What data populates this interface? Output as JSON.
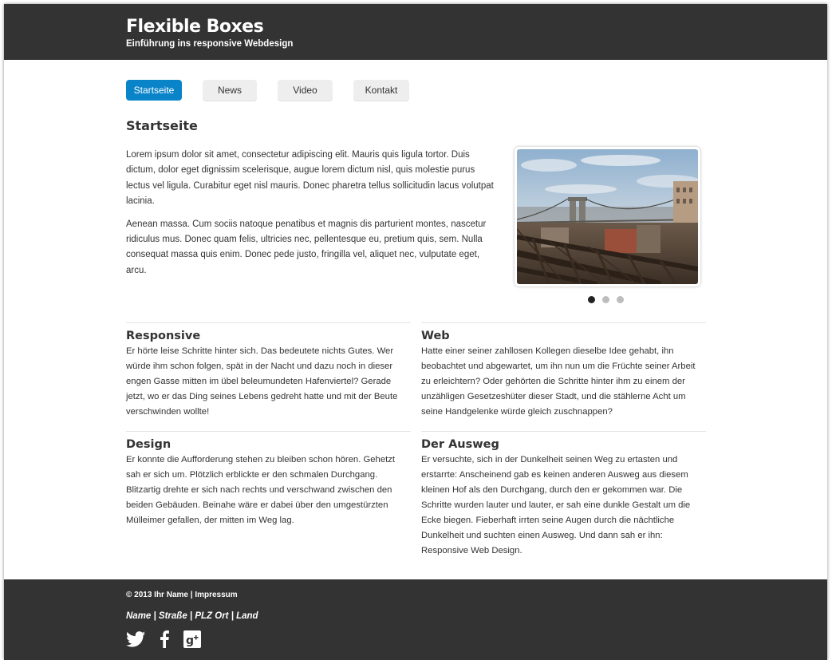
{
  "header": {
    "title": "Flexible Boxes",
    "subtitle": "Einführung ins responsive Webdesign"
  },
  "nav": {
    "items": [
      {
        "label": "Startseite",
        "active": true
      },
      {
        "label": "News",
        "active": false
      },
      {
        "label": "Video",
        "active": false
      },
      {
        "label": "Kontakt",
        "active": false
      }
    ]
  },
  "main": {
    "title": "Startseite",
    "paragraphs": [
      "Lorem ipsum dolor sit amet, consectetur adipiscing elit. Mauris quis ligula tortor. Duis dictum, dolor eget dignissim scelerisque, augue lorem dictum nisl, quis molestie purus lectus vel ligula. Curabitur eget nisl mauris. Donec pharetra tellus sollicitudin lacus volutpat lacinia.",
      "Aenean massa. Cum sociis natoque penatibus et magnis dis parturient montes, nascetur ridiculus mus. Donec quam felis, ultricies nec, pellentesque eu, pretium quis, sem. Nulla consequat massa quis enim. Donec pede justo, fringilla vel, aliquet nec, vulputate eget, arcu."
    ]
  },
  "slider": {
    "slide_count": 3,
    "active_index": 0
  },
  "sections": [
    {
      "title": "Responsive",
      "text": "Er hörte leise Schritte hinter sich. Das bedeutete nichts Gutes. Wer würde ihm schon folgen, spät in der Nacht und dazu noch in dieser engen Gasse mitten im übel beleumundeten Hafenviertel? Gerade jetzt, wo er das Ding seines Lebens gedreht hatte und mit der Beute verschwinden wollte!"
    },
    {
      "title": "Web",
      "text": "Hatte einer seiner zahllosen Kollegen dieselbe Idee gehabt, ihn beobachtet und abgewartet, um ihn nun um die Früchte seiner Arbeit zu erleichtern? Oder gehörten die Schritte hinter ihm zu einem der unzähligen Gesetzeshüter dieser Stadt, und die stählerne Acht um seine Handgelenke würde gleich zuschnappen?"
    },
    {
      "title": "Design",
      "text": "Er konnte die Aufforderung stehen zu bleiben schon hören. Gehetzt sah er sich um. Plötzlich erblickte er den schmalen Durchgang. Blitzartig drehte er sich nach rechts und verschwand zwischen den beiden Gebäuden. Beinahe wäre er dabei über den umgestürzten Mülleimer gefallen, der mitten im Weg lag."
    },
    {
      "title": "Der Ausweg",
      "text": "Er versuchte, sich in der Dunkelheit seinen Weg zu ertasten und erstarrte: Anscheinend gab es keinen anderen Ausweg aus diesem kleinen Hof als den Durchgang, durch den er gekommen war. Die Schritte wurden lauter und lauter, er sah eine dunkle Gestalt um die Ecke biegen. Fieberhaft irrten seine Augen durch die nächtliche Dunkelheit und suchten einen Ausweg. Und dann sah er ihn: Responsive Web Design."
    }
  ],
  "footer": {
    "copyright": "© 2013 Ihr Name | Impressum",
    "address": "Name | Straße | PLZ Ort | Land",
    "social_icons": [
      "twitter-icon",
      "facebook-icon",
      "google-plus-icon"
    ]
  },
  "colors": {
    "header_bg": "#333333",
    "accent": "#0a84c9",
    "nav_bg": "#eeeeee"
  }
}
